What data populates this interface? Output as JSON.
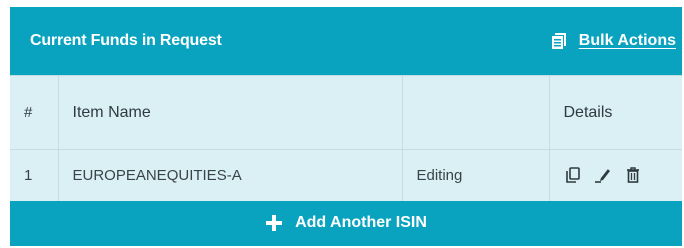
{
  "header": {
    "title": "Current Funds in Request",
    "bulk_actions_label": "Bulk Actions",
    "bulk_actions_icon": "document-list-icon"
  },
  "table": {
    "columns": [
      "#",
      "Item Name",
      "",
      "Details"
    ],
    "rows": [
      {
        "index": "1",
        "item_name": "EUROPEANEQUITIES-A",
        "status": "Editing",
        "icons": [
          "copy-icon",
          "edit-icon",
          "delete-icon"
        ]
      }
    ]
  },
  "footer": {
    "add_label": "Add Another ISIN",
    "add_icon": "plus-icon"
  },
  "colors": {
    "accent": "#0aa3bf",
    "row_background": "#daf0f5",
    "border": "#c4dde3"
  }
}
